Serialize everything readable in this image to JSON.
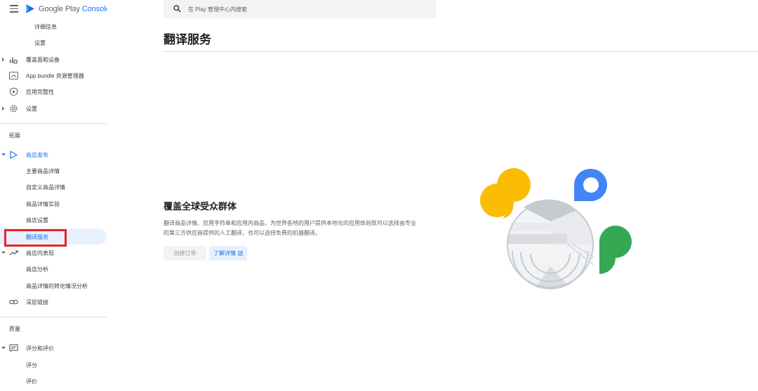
{
  "app": {
    "logo_text_google_play": "Google Play",
    "logo_text_console": "Console"
  },
  "search": {
    "placeholder": "在 Play 管理中心内搜索"
  },
  "sidebar": {
    "items_top": [
      {
        "label": "详细信息"
      },
      {
        "label": "设置"
      }
    ],
    "coverage": "覆盖面和设备",
    "bundle": "App bundle 资源管理器",
    "integrity": "应用完整性",
    "settings": "设置",
    "section_grow": "拓展",
    "store_presence": "商店发布",
    "store_presence_items": [
      {
        "label": "主要商品详情"
      },
      {
        "label": "自定义商品详情"
      },
      {
        "label": "商品详情实验"
      },
      {
        "label": "商店设置"
      },
      {
        "label": "翻译服务"
      }
    ],
    "store_performance": "商店内表现",
    "store_performance_items": [
      {
        "label": "商店分析"
      },
      {
        "label": "商品详情的转化情况分析"
      }
    ],
    "deep_links": "深层链接",
    "section_quality": "质量",
    "ratings_reviews": "评分和评价",
    "ratings_reviews_items": [
      {
        "label": "评分"
      },
      {
        "label": "评价"
      }
    ]
  },
  "main": {
    "page_title": "翻译服务",
    "empty_state": {
      "heading": "覆盖全球受众群体",
      "description": "翻译商品详情、应用字符串和应用内商品，为世界各地的用户提供本地化的应用体验既可以选择由专业的第三方供应商提供的人工翻译，也可以选择免费的机器翻译。",
      "create_order_label": "创建订单",
      "learn_more_label": "了解详情"
    }
  },
  "colors": {
    "accent": "#1a73e8",
    "highlight_border": "#e8232a",
    "yellow": "#fbbc04",
    "blue": "#4285f4",
    "green": "#34a853"
  }
}
